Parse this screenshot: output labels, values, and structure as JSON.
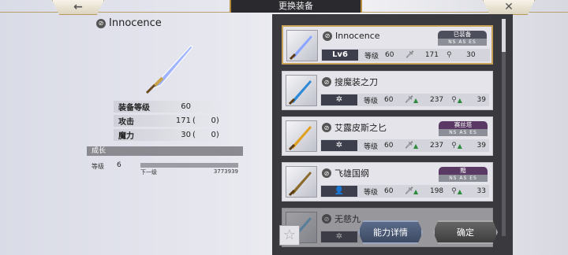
{
  "header": {
    "title": "更换装备"
  },
  "detail": {
    "name": "Innocence",
    "stats": [
      {
        "label": "装备等级",
        "value": "60",
        "bonus": ""
      },
      {
        "label": "攻击",
        "value": "171",
        "bonus": "0"
      },
      {
        "label": "魔力",
        "value": "30",
        "bonus": "0"
      }
    ],
    "growth": {
      "title": "成长",
      "level_label": "等级",
      "level": "6",
      "next_label": "下一级",
      "next_exp": "3773939"
    }
  },
  "list": [
    {
      "name": "Innocence",
      "selected": true,
      "tag_top": "已装备",
      "tag_bottom": "NS  AS  ES",
      "lv_label": "Lv6",
      "level_label": "等级",
      "level": "60",
      "atk": "171",
      "atk_up": false,
      "mag": "30",
      "mag_up": false,
      "blade_color": "#8aa6ff"
    },
    {
      "name": "搜魔装之刀",
      "selected": false,
      "tag_top": "",
      "tag_bottom": "",
      "lv_label": "✲",
      "level_label": "等级",
      "level": "60",
      "atk": "237",
      "atk_up": true,
      "mag": "39",
      "mag_up": true,
      "blade_color": "#2d8ad6"
    },
    {
      "name": "艾露皮斯之匕",
      "selected": false,
      "tag_top": "赛丝塔",
      "tag_bottom": "NS  AS  ES",
      "lv_label": "✲",
      "level_label": "等级",
      "level": "60",
      "atk": "237",
      "atk_up": true,
      "mag": "39",
      "mag_up": true,
      "blade_color": "#e0a020"
    },
    {
      "name": "飞雄国纲",
      "selected": false,
      "tag_top": "黯",
      "tag_bottom": "NS  AS  ES",
      "lv_label": "👤",
      "level_label": "等级",
      "level": "60",
      "atk": "198",
      "atk_up": true,
      "mag": "33",
      "mag_up": true,
      "blade_color": "#8b6a2a"
    },
    {
      "name": "无慈九",
      "selected": false,
      "tag_top": "",
      "tag_bottom": "",
      "lv_label": "✲",
      "level_label": "",
      "level": "",
      "atk": "",
      "atk_up": false,
      "mag": "",
      "mag_up": false,
      "blade_color": "#6fb6e8"
    }
  ],
  "buttons": {
    "ability": "能力详情",
    "confirm": "确定"
  },
  "icons": {
    "back": "back-arrow-icon",
    "close": "close-icon",
    "star": "star-icon"
  }
}
